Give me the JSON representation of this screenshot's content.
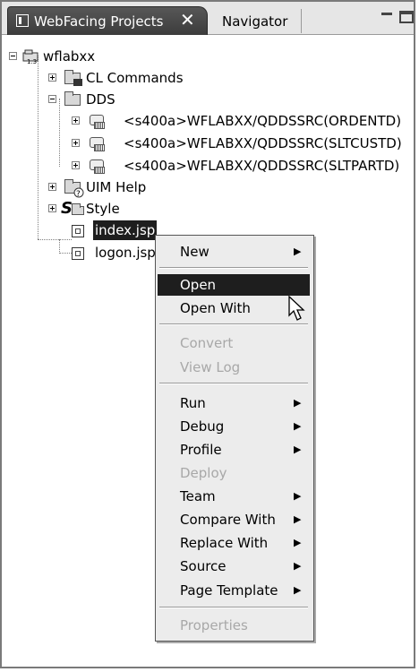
{
  "tabs": {
    "active_label": "WebFacing Projects",
    "inactive_label": "Navigator"
  },
  "tree": {
    "root": "wflabxx",
    "cl_commands": "CL Commands",
    "dds": "DDS",
    "dds_items": [
      "<s400a>WFLABXX/QDDSSRC(ORDENTD)",
      "<s400a>WFLABXX/QDDSSRC(SLTCUSTD)",
      "<s400a>WFLABXX/QDDSSRC(SLTPARTD)"
    ],
    "uim_help": "UIM Help",
    "style": "Style",
    "index": "index.jsp",
    "logon": "logon.jsp"
  },
  "menu": {
    "new": "New",
    "open": "Open",
    "open_with": "Open With",
    "convert": "Convert",
    "view_log": "View Log",
    "run": "Run",
    "debug": "Debug",
    "profile": "Profile",
    "deploy": "Deploy",
    "team": "Team",
    "compare_with": "Compare With",
    "replace_with": "Replace With",
    "source": "Source",
    "page_template": "Page Template",
    "properties": "Properties"
  }
}
